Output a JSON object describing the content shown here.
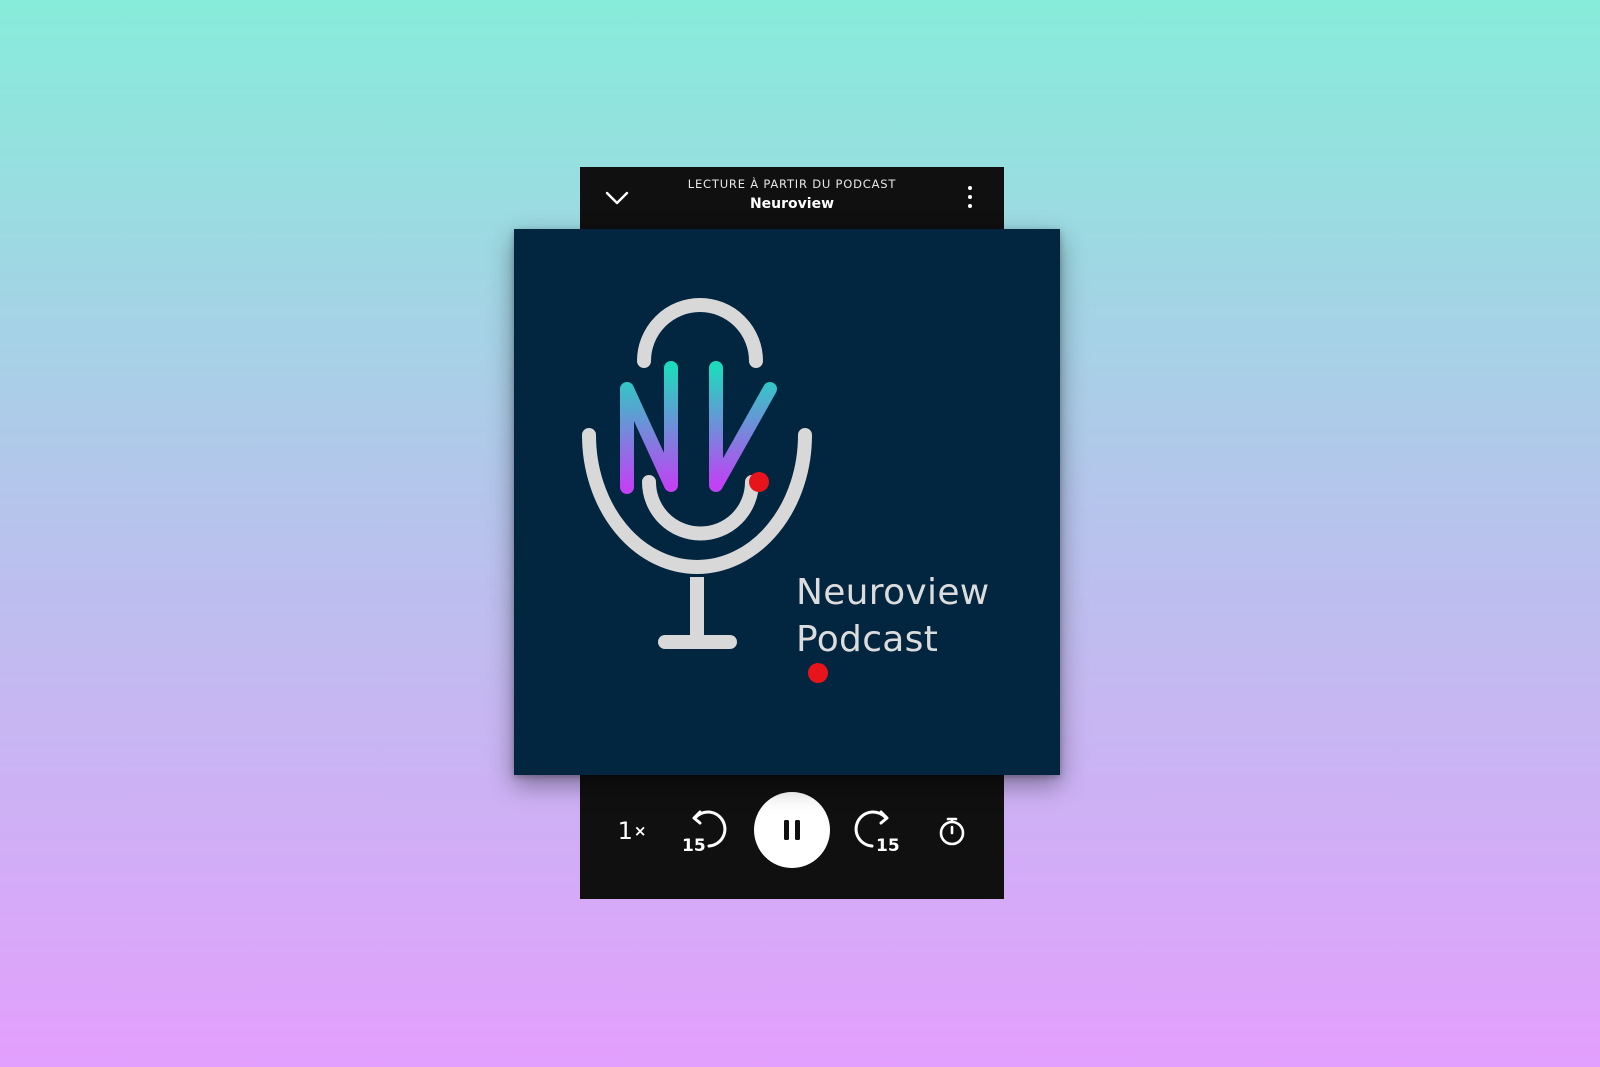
{
  "header": {
    "subtitle": "LECTURE À PARTIR DU PODCAST",
    "title": "Neuroview"
  },
  "cover": {
    "logo_monogram": "NV",
    "title_line1": "Neuroview",
    "title_line2": "Podcast"
  },
  "controls": {
    "speed_value": "1",
    "speed_suffix": "×",
    "rewind_seconds": "15",
    "forward_seconds": "15"
  },
  "icons": {
    "collapse": "chevron-down-icon",
    "more": "more-vertical-icon",
    "rewind": "rewind-15-icon",
    "pause": "pause-icon",
    "forward": "forward-15-icon",
    "sleep_timer": "stopwatch-icon"
  },
  "colors": {
    "background_top": "#87ecda",
    "background_bottom": "#e39ffd",
    "player_bg": "#101010",
    "cover_bg": "#022540",
    "record_dot": "#e8141b",
    "logo_gradient_top": "#1fd9be",
    "logo_gradient_bottom": "#c042f4"
  }
}
